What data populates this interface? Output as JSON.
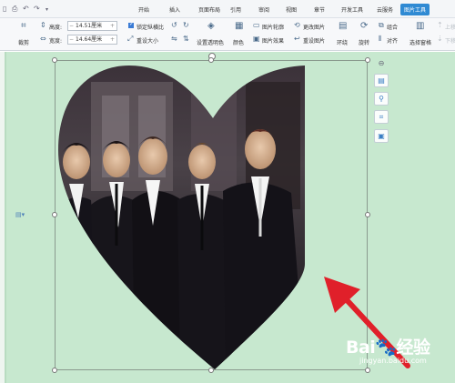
{
  "menu": {
    "tabs": [
      "开始",
      "插入",
      "页面布局",
      "引用",
      "审阅",
      "视图",
      "章节",
      "开发工具",
      "云服务"
    ],
    "active_tab": "图片工具"
  },
  "ribbon": {
    "crop_label": "裁剪",
    "height_label": "高度:",
    "height_value": "14.51厘米",
    "width_label": "宽度:",
    "width_value": "14.64厘米",
    "lock_ratio_label": "锁定纵横比",
    "reset_size_label": "重设大小",
    "transparent_label": "设置透明色",
    "color_label": "颜色",
    "outline_label": "图片轮廓",
    "effects_label": "图片效果",
    "change_label": "更改图片",
    "reset_label": "重设图片",
    "wrap_label": "环绕",
    "rotate_label": "旋转",
    "group_label": "组合",
    "align_label": "对齐",
    "select_pane_label": "选择窗格",
    "up_label": "上移",
    "down_label": "下移"
  },
  "watermark": {
    "main": "Bai🐾经验",
    "sub": "jingyan.baidu.com"
  },
  "colors": {
    "canvas": "#c7e8cf",
    "accent": "#2f8ad3",
    "arrow": "#e0202a"
  }
}
